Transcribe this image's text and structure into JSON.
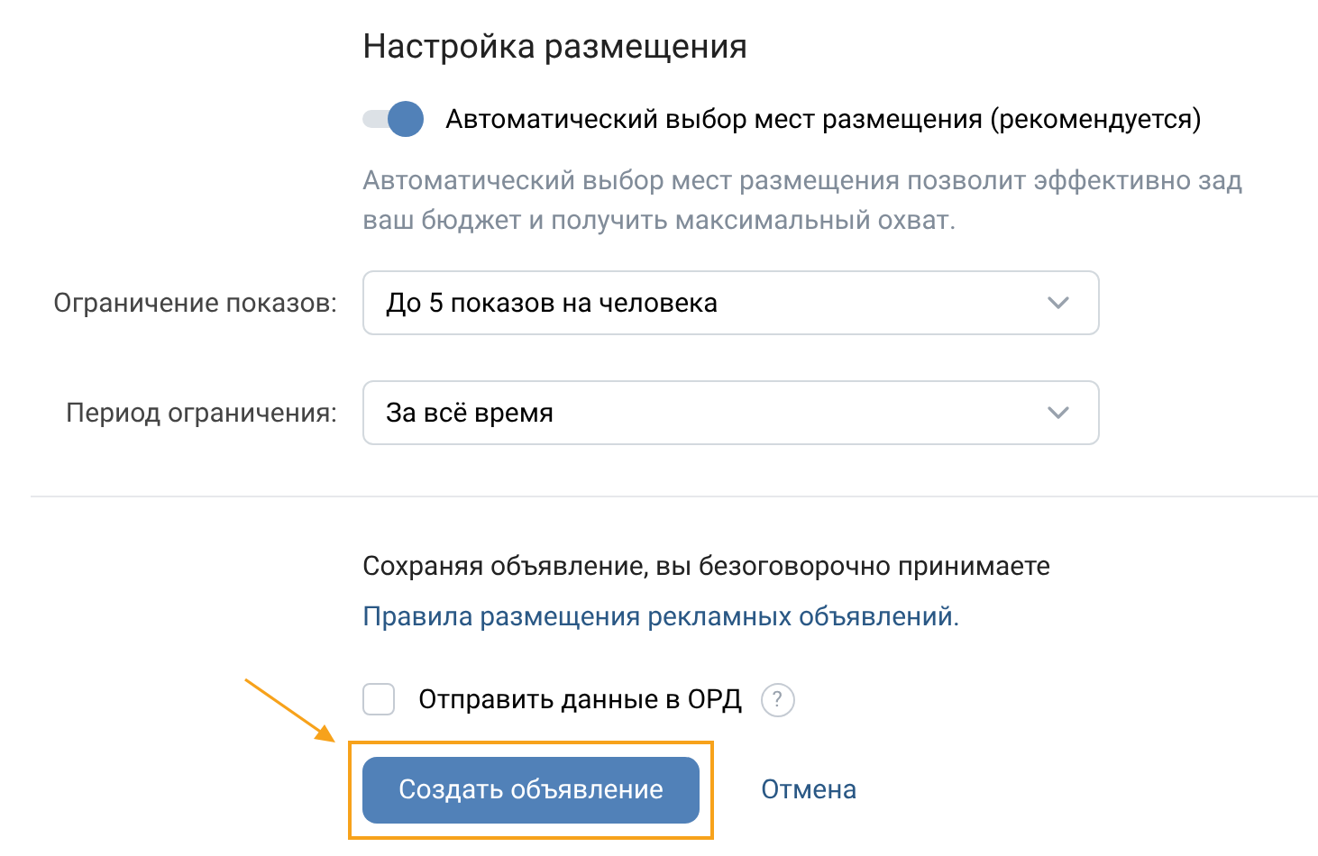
{
  "placement": {
    "title": "Настройка размещения",
    "auto_toggle": {
      "label": "Автоматический выбор мест размещения (рекомендуется)",
      "on": true
    },
    "hint_lines": [
      "Автоматический выбор мест размещения позволит эффективно зад",
      "ваш бюджет и получить максимальный охват."
    ]
  },
  "fields": [
    {
      "label": "Ограничение показов:",
      "value": "До 5 показов на человека"
    },
    {
      "label": "Период ограничения:",
      "value": "За всё время"
    }
  ],
  "agreement": {
    "text": "Сохраняя объявление, вы безоговорочно принимаете",
    "link": "Правила размещения рекламных объявлений."
  },
  "ord_checkbox": {
    "label": "Отправить данные в ОРД",
    "checked": false,
    "help": "?"
  },
  "buttons": {
    "primary": "Создать объявление",
    "cancel": "Отмена"
  },
  "annotation": {
    "highlighted": true
  }
}
